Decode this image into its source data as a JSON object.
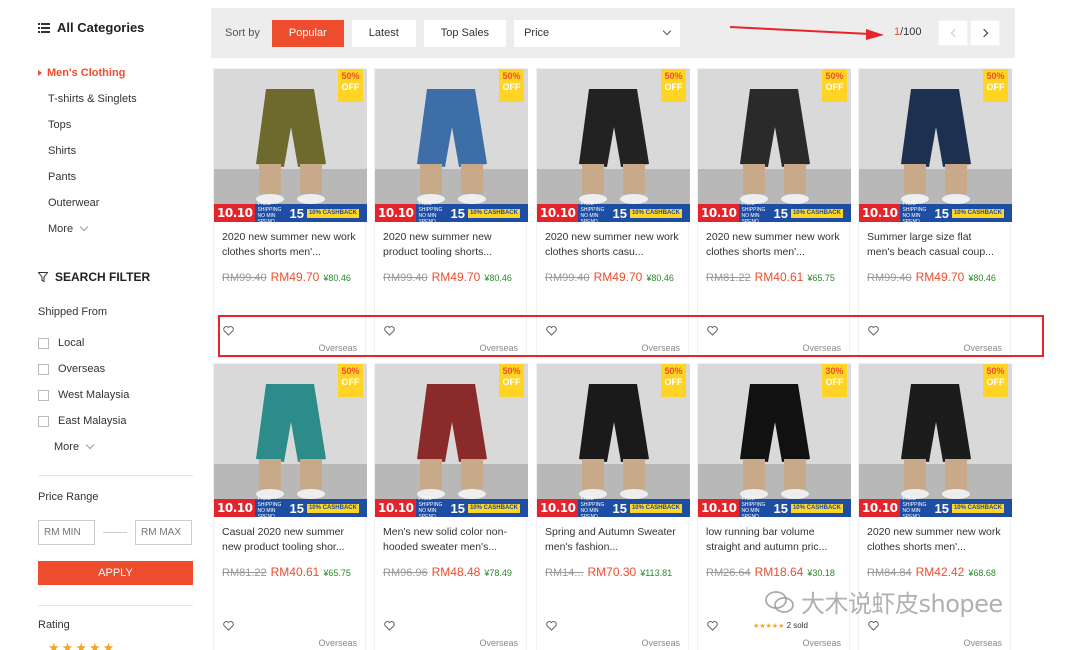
{
  "sidebar": {
    "categories_title": "All Categories",
    "categories": [
      {
        "label": "Men's Clothing",
        "active": true
      },
      {
        "label": "T-shirts & Singlets",
        "active": false
      },
      {
        "label": "Tops",
        "active": false
      },
      {
        "label": "Shirts",
        "active": false
      },
      {
        "label": "Pants",
        "active": false
      },
      {
        "label": "Outerwear",
        "active": false
      }
    ],
    "more_label": "More",
    "filter_title": "SEARCH FILTER",
    "shipped_from_title": "Shipped From",
    "shipped_from": [
      "Local",
      "Overseas",
      "West Malaysia",
      "East Malaysia"
    ],
    "shipped_more_label": "More",
    "price_range_title": "Price Range",
    "min_placeholder": "RM MIN",
    "max_placeholder": "RM MAX",
    "apply_label": "APPLY",
    "rating_title": "Rating"
  },
  "sortbar": {
    "label": "Sort by",
    "options": [
      "Popular",
      "Latest",
      "Top Sales"
    ],
    "active": "Popular",
    "price_label": "Price",
    "page_current": "1",
    "page_total": "/100"
  },
  "promo": {
    "date": "10.10",
    "text": "FREE SHIPPING NO MIN SPEND",
    "big": "15",
    "cashback": "10% CASHBACK"
  },
  "products": [
    {
      "name": "2020 new summer new work clothes shorts men'...",
      "old": "RM99.40",
      "new": "RM49.70",
      "yuan": "¥80.46",
      "discount": "50%",
      "off": "OFF",
      "loc": "Overseas",
      "sold": "",
      "color": "#6e6a2e"
    },
    {
      "name": "2020 new summer new product tooling shorts...",
      "old": "RM99.40",
      "new": "RM49.70",
      "yuan": "¥80.46",
      "discount": "50%",
      "off": "OFF",
      "loc": "Overseas",
      "sold": "",
      "color": "#3e6ea8"
    },
    {
      "name": "2020 new summer new work clothes shorts casu...",
      "old": "RM99.40",
      "new": "RM49.70",
      "yuan": "¥80.46",
      "discount": "50%",
      "off": "OFF",
      "loc": "Overseas",
      "sold": "",
      "color": "#222222"
    },
    {
      "name": "2020 new summer new work clothes shorts men'...",
      "old": "RM81.22",
      "new": "RM40.61",
      "yuan": "¥65.75",
      "discount": "50%",
      "off": "OFF",
      "loc": "Overseas",
      "sold": "",
      "color": "#2a2a2a"
    },
    {
      "name": "Summer large size flat men's beach casual coup...",
      "old": "RM99.40",
      "new": "RM49.70",
      "yuan": "¥80.46",
      "discount": "50%",
      "off": "OFF",
      "loc": "Overseas",
      "sold": "",
      "color": "#1e3050"
    },
    {
      "name": "Casual 2020 new summer new product tooling shor...",
      "old": "RM81.22",
      "new": "RM40.61",
      "yuan": "¥65.75",
      "discount": "50%",
      "off": "OFF",
      "loc": "Overseas",
      "sold": "",
      "color": "#2c8c8a"
    },
    {
      "name": "Men's new solid color non-hooded sweater men's...",
      "old": "RM96.96",
      "new": "RM48.48",
      "yuan": "¥78.49",
      "discount": "50%",
      "off": "OFF",
      "loc": "Overseas",
      "sold": "",
      "color": "#8a2a2a"
    },
    {
      "name": "Spring and Autumn Sweater men's fashion...",
      "old": "RM14...",
      "new": "RM70.30",
      "yuan": "¥113.81",
      "discount": "50%",
      "off": "OFF",
      "loc": "Overseas",
      "sold": "",
      "color": "#1a1a1a"
    },
    {
      "name": "low running bar volume straight and autumn pric...",
      "old": "RM26.64",
      "new": "RM18.64",
      "yuan": "¥30.18",
      "discount": "30%",
      "off": "OFF",
      "loc": "Overseas",
      "sold": "2 sold",
      "color": "#111111"
    },
    {
      "name": "2020 new summer new work clothes shorts men'...",
      "old": "RM84.84",
      "new": "RM42.42",
      "yuan": "¥68.68",
      "discount": "50%",
      "off": "OFF",
      "loc": "Overseas",
      "sold": "",
      "color": "#1c1c1c"
    }
  ],
  "watermark": "大木说虾皮shopee"
}
